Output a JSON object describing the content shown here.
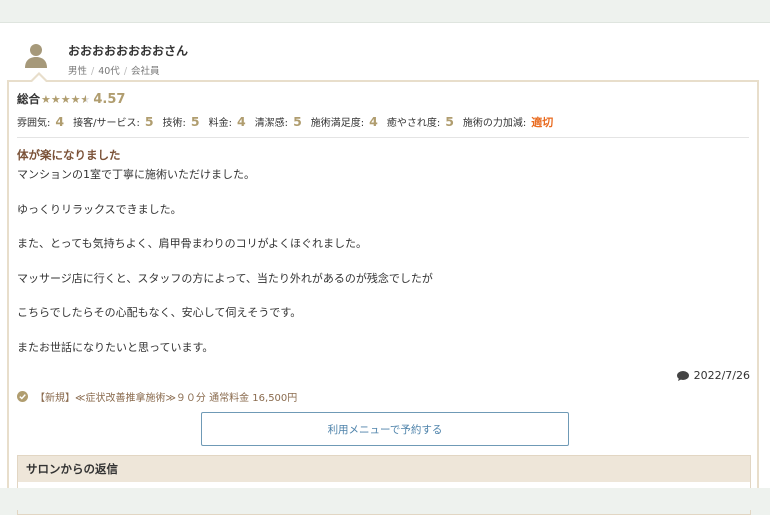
{
  "reviewer": {
    "name": "おおおおおおおおさん",
    "gender": "男性",
    "age": "40代",
    "occupation": "会社員",
    "separator": "/"
  },
  "rating": {
    "overall_label": "総合",
    "overall_score": "4.57",
    "stars": 4.5,
    "categories": [
      {
        "label": "雰囲気:",
        "value": "4"
      },
      {
        "label": "接客/サービス:",
        "value": "5"
      },
      {
        "label": "技術:",
        "value": "5"
      },
      {
        "label": "料金:",
        "value": "4"
      },
      {
        "label": "清潔感:",
        "value": "5"
      },
      {
        "label": "施術満足度:",
        "value": "4"
      },
      {
        "label": "癒やされ度:",
        "value": "5"
      },
      {
        "label": "施術の力加減:",
        "value": "適切"
      }
    ]
  },
  "review": {
    "title": "体が楽になりました",
    "lines": [
      "マンションの1室で丁寧に施術いただけました。",
      "ゆっくりリラックスできました。",
      "また、とっても気持ちよく、肩甲骨まわりのコリがよくほぐれました。",
      "マッサージ店に行くと、スタッフの方によって、当たり外れがあるのが残念でしたが",
      "こちらでしたらその心配もなく、安心して伺えそうです。",
      "またお世話になりたいと思っています。"
    ],
    "date": "2022/7/26"
  },
  "menu": {
    "text": "【新規】≪症状改善推拿施術≫９０分 通常料金 16,500円"
  },
  "reserve_button": {
    "label": "利用メニューで予約する"
  },
  "salon_reply": {
    "heading": "サロンからの返信"
  },
  "colors": {
    "accent_gold": "#b09d6f",
    "title_brown": "#7b5238",
    "pressure_orange": "#e96b20",
    "link_blue": "#4d82aa"
  },
  "icons": {
    "avatar": "person-icon",
    "comment": "speech-bubble-icon",
    "menu": "check-circle-icon"
  }
}
